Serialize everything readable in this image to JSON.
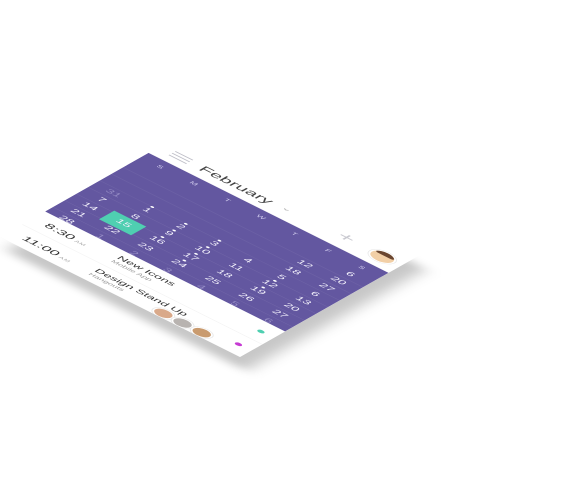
{
  "header": {
    "month": "February",
    "chevron": "⌄",
    "add": "+"
  },
  "calendar": {
    "weekdays": [
      "S",
      "M",
      "T",
      "W",
      "T",
      "F",
      "S"
    ],
    "rows": [
      [
        "",
        "",
        "",
        "",
        "",
        "",
        "6"
      ],
      [
        "",
        "",
        "",
        "",
        "",
        "12",
        "20"
      ],
      [
        "",
        "",
        "",
        "",
        "",
        "18",
        "27"
      ],
      [
        "31",
        "1",
        "2",
        "3",
        "4",
        "5",
        "6"
      ],
      [
        "7",
        "8",
        "9",
        "10",
        "11",
        "12",
        "13"
      ],
      [
        "14",
        "15",
        "16",
        "17",
        "18",
        "19",
        "20"
      ],
      [
        "21",
        "22",
        "23",
        "24",
        "25",
        "26",
        "27"
      ],
      [
        "28",
        "1",
        "2",
        "3",
        "4",
        "5",
        "6"
      ]
    ],
    "selected": "15"
  },
  "events": [
    {
      "time": "8:30",
      "ampm": "AM",
      "title": "New Icons",
      "subtitle": "Mobile App",
      "color": "#4fcfb1"
    },
    {
      "time": "11:00",
      "ampm": "AM",
      "title": "Design Stand Up",
      "subtitle": "Hangouts",
      "color": "#c63bd3"
    }
  ],
  "colors": {
    "calendar_bg": "#6357a0",
    "selected": "#4fcfb1",
    "accent_purple": "#c63bd3"
  }
}
